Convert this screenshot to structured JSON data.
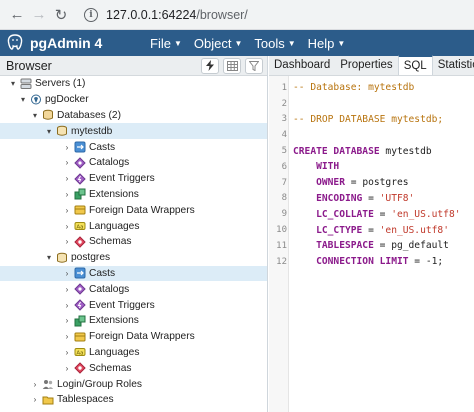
{
  "browser_chrome": {
    "url_host": "127.0.0.1:64224",
    "url_path": "/browser/"
  },
  "app": {
    "brand": "pgAdmin 4",
    "menu": [
      "File",
      "Object",
      "Tools",
      "Help"
    ],
    "header_color": "#2c5c8a"
  },
  "left_panel": {
    "title": "Browser",
    "tree": [
      {
        "label": "Servers (1)",
        "toggle": "▾",
        "icon": "servers-icon",
        "selected": false
      },
      {
        "label": "pgDocker",
        "toggle": "▾",
        "icon": "server-icon",
        "selected": false
      },
      {
        "label": "Databases (2)",
        "toggle": "▾",
        "icon": "databases-icon",
        "selected": false
      },
      {
        "label": "mytestdb",
        "toggle": "▾",
        "icon": "database-icon",
        "selected": true
      },
      {
        "label": "Casts",
        "toggle": "›",
        "icon": "casts-icon",
        "selected": false
      },
      {
        "label": "Catalogs",
        "toggle": "›",
        "icon": "catalogs-icon",
        "selected": false
      },
      {
        "label": "Event Triggers",
        "toggle": "›",
        "icon": "event-triggers-icon",
        "selected": false
      },
      {
        "label": "Extensions",
        "toggle": "›",
        "icon": "extensions-icon",
        "selected": false
      },
      {
        "label": "Foreign Data Wrappers",
        "toggle": "›",
        "icon": "foreign-data-wrappers-icon",
        "selected": false
      },
      {
        "label": "Languages",
        "toggle": "›",
        "icon": "languages-icon",
        "selected": false
      },
      {
        "label": "Schemas",
        "toggle": "›",
        "icon": "schemas-icon",
        "selected": false
      },
      {
        "label": "postgres",
        "toggle": "▾",
        "icon": "database-icon",
        "selected": false
      },
      {
        "label": "Casts",
        "toggle": "›",
        "icon": "casts-icon",
        "selected": true
      },
      {
        "label": "Catalogs",
        "toggle": "›",
        "icon": "catalogs-icon",
        "selected": false
      },
      {
        "label": "Event Triggers",
        "toggle": "›",
        "icon": "event-triggers-icon",
        "selected": false
      },
      {
        "label": "Extensions",
        "toggle": "›",
        "icon": "extensions-icon",
        "selected": false
      },
      {
        "label": "Foreign Data Wrappers",
        "toggle": "›",
        "icon": "foreign-data-wrappers-icon",
        "selected": false
      },
      {
        "label": "Languages",
        "toggle": "›",
        "icon": "languages-icon",
        "selected": false
      },
      {
        "label": "Schemas",
        "toggle": "›",
        "icon": "schemas-icon",
        "selected": false
      },
      {
        "label": "Login/Group Roles",
        "toggle": "›",
        "icon": "roles-icon",
        "selected": false
      },
      {
        "label": "Tablespaces",
        "toggle": "›",
        "icon": "tablespaces-icon",
        "selected": false
      }
    ]
  },
  "right_panel": {
    "tabs": [
      "Dashboard",
      "Properties",
      "SQL",
      "Statistics"
    ],
    "active_tab": "SQL",
    "sql_lines": [
      {
        "num": "1",
        "segments": [
          {
            "t": "-- Database: mytestdb",
            "c": "cm"
          }
        ]
      },
      {
        "num": "2",
        "segments": []
      },
      {
        "num": "3",
        "segments": [
          {
            "t": "-- DROP DATABASE mytestdb;",
            "c": "cm"
          }
        ]
      },
      {
        "num": "4",
        "segments": []
      },
      {
        "num": "5",
        "segments": [
          {
            "t": "CREATE DATABASE ",
            "c": "kw"
          },
          {
            "t": "mytestdb",
            "c": "tx"
          }
        ]
      },
      {
        "num": "6",
        "segments": [
          {
            "t": "    WITH",
            "c": "kw"
          }
        ]
      },
      {
        "num": "7",
        "segments": [
          {
            "t": "    OWNER ",
            "c": "kw"
          },
          {
            "t": "= postgres",
            "c": "tx"
          }
        ]
      },
      {
        "num": "8",
        "segments": [
          {
            "t": "    ENCODING ",
            "c": "kw"
          },
          {
            "t": "= ",
            "c": "tx"
          },
          {
            "t": "'UTF8'",
            "c": "st"
          }
        ]
      },
      {
        "num": "9",
        "segments": [
          {
            "t": "    LC_COLLATE ",
            "c": "kw"
          },
          {
            "t": "= ",
            "c": "tx"
          },
          {
            "t": "'en_US.utf8'",
            "c": "st"
          }
        ]
      },
      {
        "num": "10",
        "segments": [
          {
            "t": "    LC_CTYPE ",
            "c": "kw"
          },
          {
            "t": "= ",
            "c": "tx"
          },
          {
            "t": "'en_US.utf8'",
            "c": "st"
          }
        ]
      },
      {
        "num": "11",
        "segments": [
          {
            "t": "    TABLESPACE ",
            "c": "kw"
          },
          {
            "t": "= pg_default",
            "c": "tx"
          }
        ]
      },
      {
        "num": "12",
        "segments": [
          {
            "t": "    CONNECTION LIMIT ",
            "c": "kw"
          },
          {
            "t": "= -1;",
            "c": "tx"
          }
        ]
      }
    ]
  }
}
